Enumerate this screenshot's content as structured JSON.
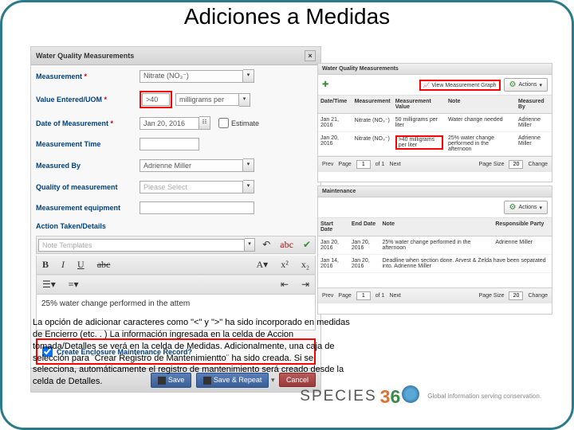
{
  "title": "Adiciones a Medidas",
  "form": {
    "panel_title": "Water Quality Measurements",
    "measurement_label": "Measurement",
    "measurement_value": "Nitrate (NO₃⁻)",
    "value_label": "Value Entered/UOM",
    "value_entered": ">40",
    "uom": "milligrams per",
    "date_label": "Date of Measurement",
    "date_value": "Jan 20, 2016",
    "estimate_label": "Estimate",
    "time_label": "Measurement Time",
    "by_label": "Measured By",
    "by_value": "Adrienne Miller",
    "quality_label": "Quality of measurement",
    "quality_value": "Please Select",
    "equipment_label": "Measurement equipment",
    "action_label": "Action Taken/Details",
    "template_ph": "Note Templates",
    "editor_text": "25% water change performed in the attem",
    "checkbox_label": "Create Enclosure Maintenance Record?",
    "save": "Save",
    "save_repeat": "Save & Repeat",
    "cancel": "Cancel"
  },
  "meas_panel": {
    "title": "Water Quality Measurements",
    "graph_link": "View Measurement Graph",
    "actions": "Actions",
    "cols": [
      "Date/Time",
      "Measurement",
      "Measurement Value",
      "Note",
      "Measured By"
    ],
    "rows": [
      {
        "dt": "Jan 21, 2016",
        "m": "Nitrate (NO₃⁻)",
        "v": "50 milligrams per liter",
        "n": "Water change needed",
        "by": "Adrienne Miller"
      },
      {
        "dt": "Jan 20, 2016",
        "m": "Nitrate (NO₃⁻)",
        "v": ">40 milligrams per liter",
        "n": "25% water change performed in the afternoon",
        "by": "Adrienne Miller"
      }
    ],
    "page": "1",
    "of": "of 1",
    "page_label": "Page",
    "next": "Next",
    "prev": "Prev",
    "ps_label": "Page Size",
    "ps": "20",
    "change": "Change"
  },
  "maint_panel": {
    "title": "Maintenance",
    "actions": "Actions",
    "cols": [
      "Start Date",
      "End Date",
      "Note",
      "Responsible Party"
    ],
    "rows": [
      {
        "s": "Jan 20, 2016",
        "e": "Jan 20, 2016",
        "n": "25% water change performed in the afternoon",
        "r": "Adrienne Miller"
      },
      {
        "s": "Jan 14, 2016",
        "e": "Jan 20, 2016",
        "n": "Deadline when section done. Arvest & Zelda have been separated into. Adrienne Miller",
        "r": ""
      }
    ],
    "page": "1",
    "of": "of 1",
    "page_label": "Page",
    "next": "Next",
    "prev": "Prev",
    "ps_label": "Page Size",
    "ps": "20",
    "change": "Change"
  },
  "caption": "La opción de adicionar caracteres como \"<\" y \">\" ha sido incorporado en medidas de Encierro (etc. . ) La información ingresada en la celda de Accion tomada/Detalles se verá en la celda de Medidas. Adicionalmente, una caja de selección para ¨Crear Registro de Mantenimientto¨ ha sido creada. Si se selecciona, automáticamente el registro de mantenimiento será creado desde la celda de Detalles.",
  "logo": {
    "brand": "SPECIES",
    "tagline": "Global information serving conservation."
  }
}
